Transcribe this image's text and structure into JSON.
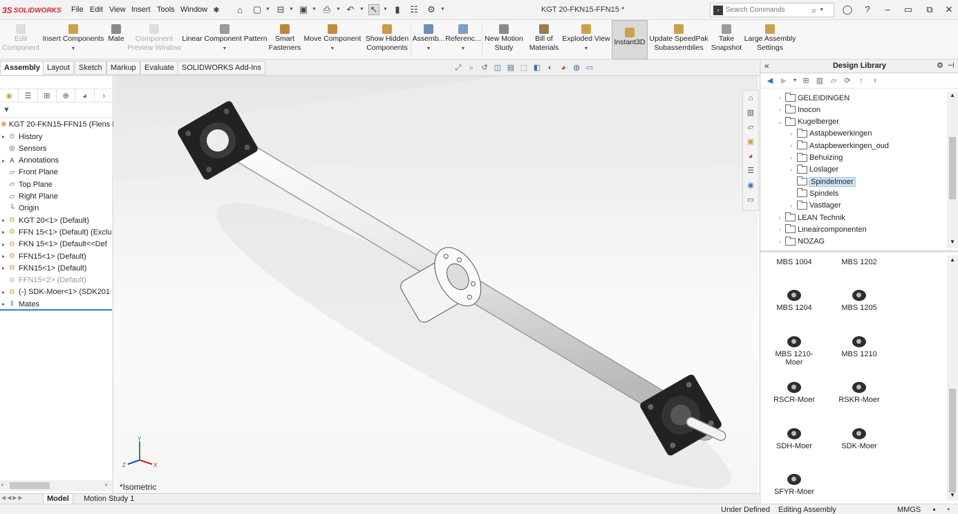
{
  "app": {
    "brand": "SOLIDWORKS",
    "document_title": "KGT 20-FKN15-FFN15 *"
  },
  "menu": [
    "File",
    "Edit",
    "View",
    "Insert",
    "Tools",
    "Window"
  ],
  "search": {
    "placeholder": "Search Commands"
  },
  "commands": [
    {
      "id": "edit-component",
      "label": "Edit Component",
      "disabled": true
    },
    {
      "id": "insert-components",
      "label": "Insert Components"
    },
    {
      "id": "mate",
      "label": "Mate"
    },
    {
      "id": "component-preview-window",
      "label": "Component Preview Window",
      "disabled": true
    },
    {
      "id": "linear-component-pattern",
      "label": "Linear Component Pattern"
    },
    {
      "id": "smart-fasteners",
      "label": "Smart Fasteners"
    },
    {
      "id": "move-component",
      "label": "Move Component"
    },
    {
      "id": "show-hidden-components",
      "label": "Show Hidden Components"
    },
    {
      "id": "assembly-features",
      "label": "Assemb..."
    },
    {
      "id": "reference-geometry",
      "label": "Referenc..."
    },
    {
      "id": "new-motion-study",
      "label": "New Motion Study"
    },
    {
      "id": "bill-of-materials",
      "label": "Bill of Materials"
    },
    {
      "id": "exploded-view",
      "label": "Exploded View"
    },
    {
      "id": "instant3d",
      "label": "Instant3D",
      "active": true
    },
    {
      "id": "update-speedpak",
      "label": "Update SpeedPak Subassemblies"
    },
    {
      "id": "take-snapshot",
      "label": "Take Snapshot"
    },
    {
      "id": "large-assembly-settings",
      "label": "Large Assembly Settings"
    }
  ],
  "tabs": [
    "Assembly",
    "Layout",
    "Sketch",
    "Markup",
    "Evaluate",
    "SOLIDWORKS Add-Ins"
  ],
  "feature_tree": {
    "root": "KGT 20-FKN15-FFN15  (Flens Ir",
    "items": [
      {
        "label": "History",
        "icon": "history-icon"
      },
      {
        "label": "Sensors",
        "icon": "sensor-icon"
      },
      {
        "label": "Annotations",
        "icon": "annotations-icon"
      },
      {
        "label": "Front Plane",
        "icon": "plane-icon"
      },
      {
        "label": "Top Plane",
        "icon": "plane-icon"
      },
      {
        "label": "Right Plane",
        "icon": "plane-icon"
      },
      {
        "label": "Origin",
        "icon": "origin-icon"
      },
      {
        "label": "KGT 20<1> (Default)",
        "icon": "part-icon"
      },
      {
        "label": "FFN 15<1> (Default) (Exclu",
        "icon": "part-icon"
      },
      {
        "label": "FKN 15<1> (Default<<Def",
        "icon": "part-icon"
      },
      {
        "label": "FFN15<1> (Default)",
        "icon": "part-icon"
      },
      {
        "label": "FKN15<1> (Default)",
        "icon": "part-icon"
      },
      {
        "label": "FFN15<2> (Default)",
        "icon": "part-icon",
        "suppressed": true
      },
      {
        "label": "(-) SDK-Moer<1> (SDK201",
        "icon": "part-icon"
      },
      {
        "label": "Mates",
        "icon": "mates-icon"
      }
    ]
  },
  "viewport": {
    "view_label": "*Isometric",
    "triad": {
      "x": "X",
      "y": "Y",
      "z": "Z"
    }
  },
  "design_library": {
    "title": "Design Library",
    "tree": [
      {
        "label": "GELEIDINGEN",
        "level": 0,
        "expanded": false
      },
      {
        "label": "Inocon",
        "level": 0,
        "expanded": false
      },
      {
        "label": "Kugelberger",
        "level": 0,
        "expanded": true
      },
      {
        "label": "Astapbewerkingen",
        "level": 1,
        "expanded": false
      },
      {
        "label": "Astapbewerkingen_oud",
        "level": 1,
        "expanded": false
      },
      {
        "label": "Behuizing",
        "level": 1,
        "expanded": false
      },
      {
        "label": "Loslager",
        "level": 1,
        "expanded": false
      },
      {
        "label": "Spindelmoer",
        "level": 1,
        "selected": true,
        "leaf": true
      },
      {
        "label": "Spindels",
        "level": 1,
        "leaf": true
      },
      {
        "label": "Vastlager",
        "level": 1,
        "expanded": false
      },
      {
        "label": "LEAN Technik",
        "level": 0,
        "expanded": false
      },
      {
        "label": "Lineaircomponenten",
        "level": 0,
        "expanded": false
      },
      {
        "label": "NOZAG",
        "level": 0,
        "expanded": false
      }
    ],
    "parts": [
      "MBS 1004",
      "MBS 1202",
      "MBS 1204",
      "MBS 1205",
      "MBS 1210-Moer",
      "MBS 1210",
      "RSCR-Moer",
      "RSKR-Moer",
      "SDH-Moer",
      "SDK-Moer",
      "SFYR-Moer"
    ]
  },
  "bottom_tabs": [
    "Model",
    "Motion Study 1"
  ],
  "status": {
    "definition": "Under Defined",
    "mode": "Editing Assembly",
    "units": "MMGS"
  },
  "colors": {
    "brand_red": "#d0282e",
    "selection_blue": "#cde4f7",
    "accent_blue": "#3c7fc1"
  }
}
